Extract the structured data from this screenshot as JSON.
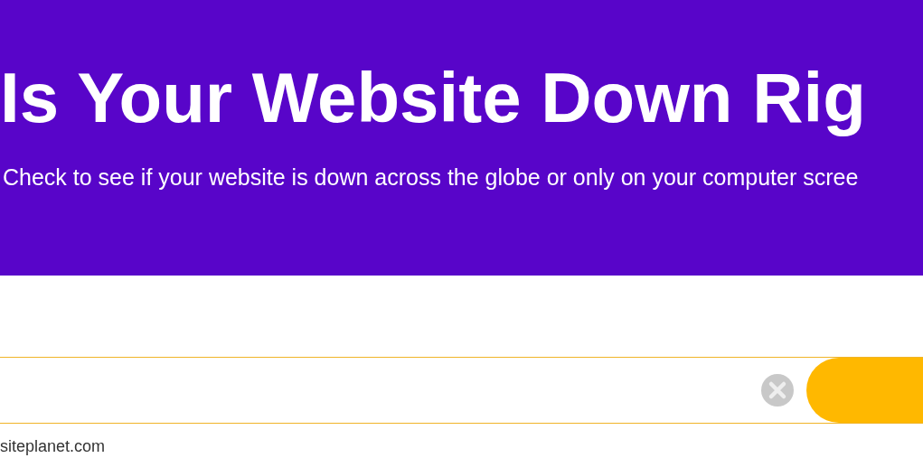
{
  "header": {
    "title": "Is Your Website Down Rig",
    "subtitle": "Check to see if your website is down across the globe or only on your computer scree"
  },
  "footer": {
    "text": "siteplanet.com"
  }
}
